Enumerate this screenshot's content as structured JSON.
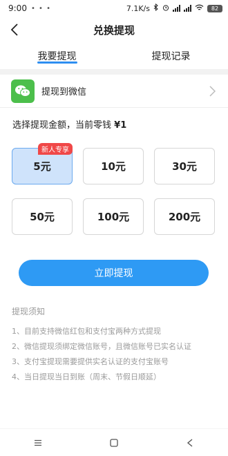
{
  "status_bar": {
    "time": "9:00",
    "dots": "• • •",
    "speed": "7.1K/s",
    "battery": "82"
  },
  "nav": {
    "title": "兑换提现"
  },
  "tabs": [
    {
      "label": "我要提现",
      "active": true
    },
    {
      "label": "提现记录",
      "active": false
    }
  ],
  "method": {
    "label": "提现到微信"
  },
  "balance": {
    "prefix": "选择提现金额，当前零钱",
    "amount": "¥1"
  },
  "amounts": [
    {
      "label": "5元",
      "selected": true,
      "badge": "新人专享"
    },
    {
      "label": "10元",
      "selected": false
    },
    {
      "label": "30元",
      "selected": false
    },
    {
      "label": "50元",
      "selected": false
    },
    {
      "label": "100元",
      "selected": false
    },
    {
      "label": "200元",
      "selected": false
    }
  ],
  "submit_label": "立即提现",
  "notes": {
    "title": "提现须知",
    "items": [
      "1、目前支持微信红包和支付宝两种方式提现",
      "2、微信提现须绑定微信账号，且微信账号已实名认证",
      "3、支付宝提现需要提供实名认证的支付宝账号",
      "4、当日提现当日到账（周末、节假日顺延）"
    ]
  },
  "colors": {
    "accent": "#2e9af4",
    "badge": "#f04848",
    "wechat": "#4cbf4b",
    "selected_bg": "#cfe3fb"
  }
}
